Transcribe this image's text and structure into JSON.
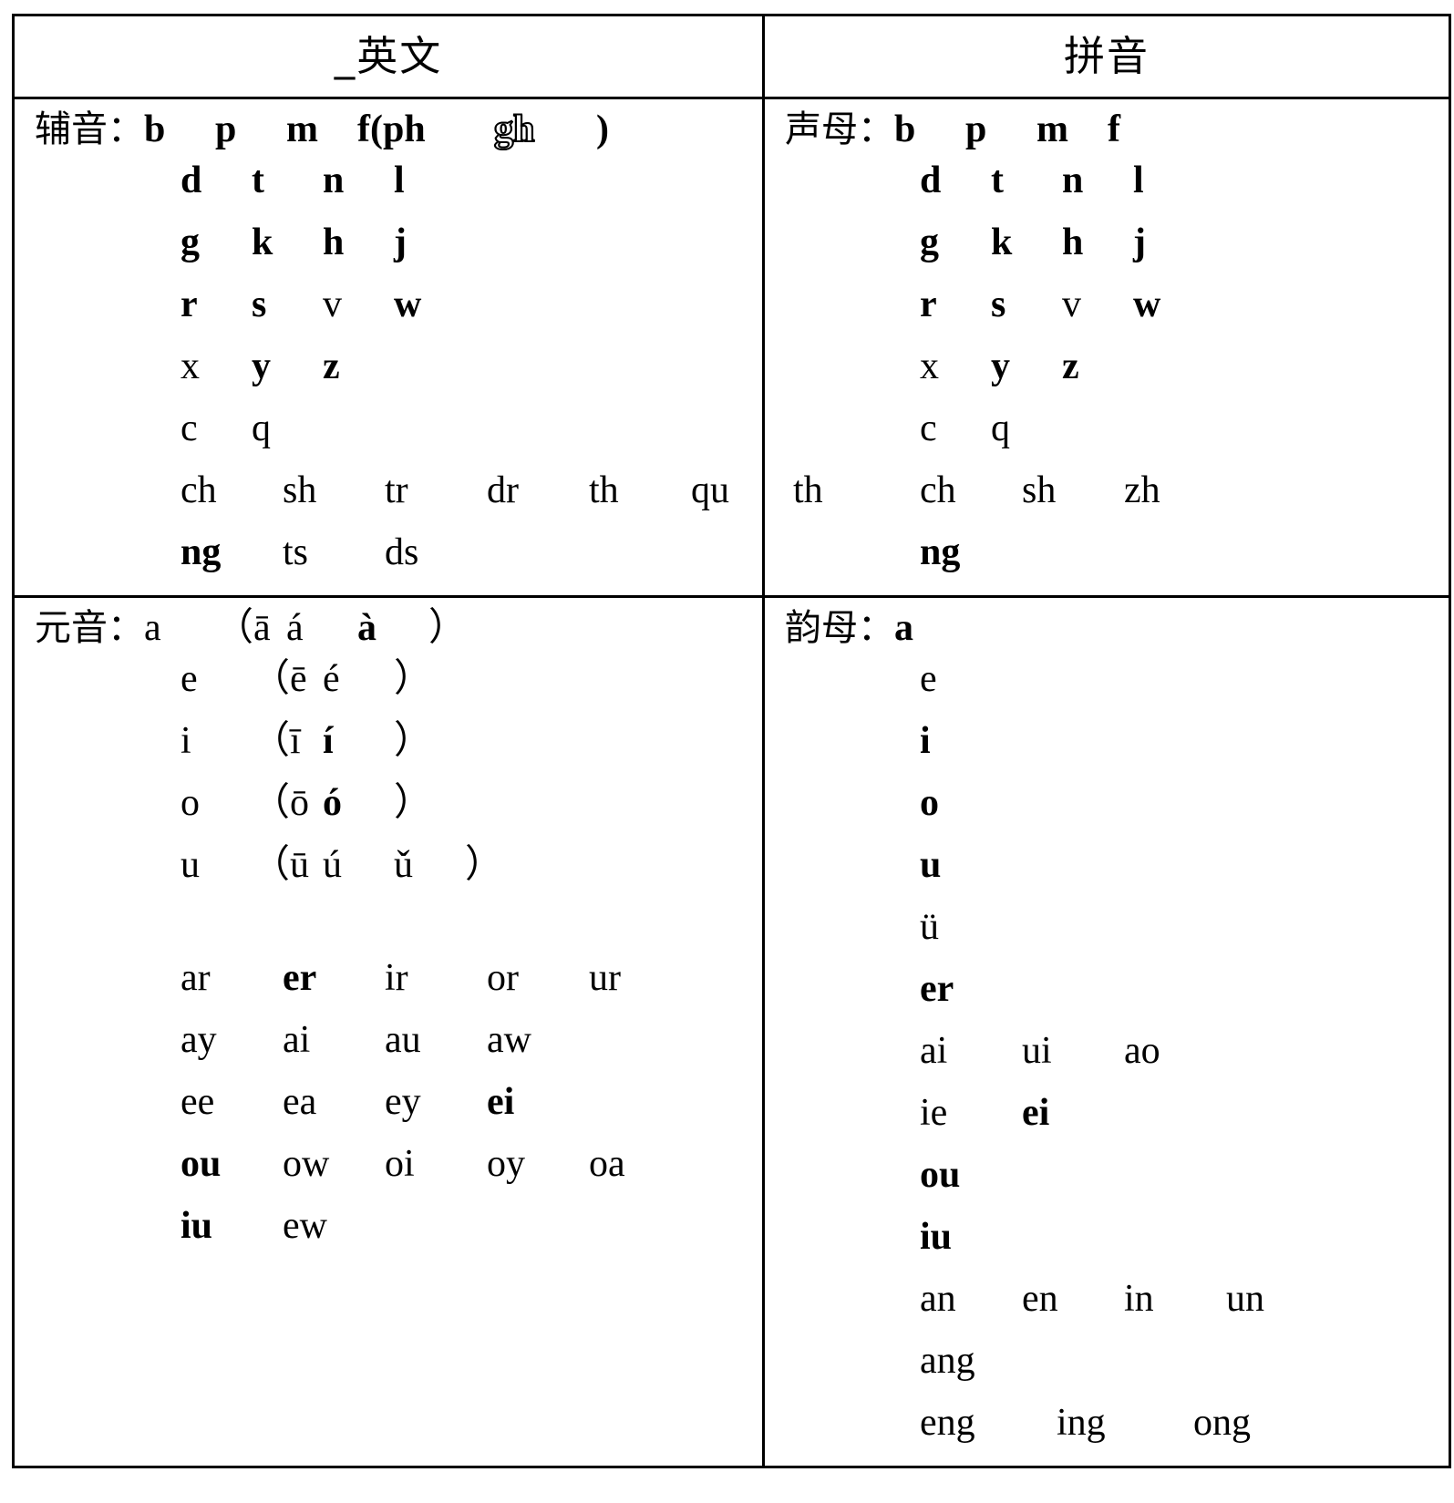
{
  "table": {
    "headers": {
      "english": "_英文",
      "pinyin": "拼音"
    },
    "rows": {
      "consonants": {
        "english": {
          "label": "辅音：",
          "lines": [
            [
              {
                "t": "b",
                "w": "bold"
              },
              {
                "t": "p",
                "w": "bold"
              },
              {
                "t": "m",
                "w": "bold"
              },
              {
                "t": "f(ph",
                "w": "bold"
              },
              {
                "t": "gh",
                "w": "outline"
              },
              {
                "t": ")",
                "w": "bold"
              }
            ],
            [
              {
                "t": "d",
                "w": "bold"
              },
              {
                "t": "t",
                "w": "bold"
              },
              {
                "t": "n",
                "w": "bold"
              },
              {
                "t": "l",
                "w": "bold"
              }
            ],
            [
              {
                "t": "g",
                "w": "bold"
              },
              {
                "t": "k",
                "w": "bold"
              },
              {
                "t": "h",
                "w": "bold"
              },
              {
                "t": "j",
                "w": "bold"
              }
            ],
            [
              {
                "t": "r",
                "w": "bold"
              },
              {
                "t": "s",
                "w": "bold"
              },
              {
                "t": "v",
                "w": "normal"
              },
              {
                "t": "w",
                "w": "bold"
              }
            ],
            [
              {
                "t": "x",
                "w": "normal"
              },
              {
                "t": "y",
                "w": "bold"
              },
              {
                "t": "z",
                "w": "bold"
              }
            ],
            [
              {
                "t": "c",
                "w": "normal"
              },
              {
                "t": "q",
                "w": "normal"
              }
            ],
            [
              {
                "t": "ch",
                "w": "normal"
              },
              {
                "t": "sh",
                "w": "normal"
              },
              {
                "t": "tr",
                "w": "normal"
              },
              {
                "t": "dr",
                "w": "normal"
              },
              {
                "t": "th",
                "w": "normal"
              },
              {
                "t": "qu",
                "w": "normal"
              },
              {
                "t": "th",
                "w": "normal"
              }
            ],
            [
              {
                "t": "ng",
                "w": "bold"
              },
              {
                "t": "ts",
                "w": "normal"
              },
              {
                "t": "ds",
                "w": "normal"
              }
            ]
          ]
        },
        "pinyin": {
          "label": "声母：",
          "lines": [
            [
              {
                "t": "b",
                "w": "bold"
              },
              {
                "t": "p",
                "w": "bold"
              },
              {
                "t": "m",
                "w": "bold"
              },
              {
                "t": "f",
                "w": "bold"
              }
            ],
            [
              {
                "t": "d",
                "w": "bold"
              },
              {
                "t": "t",
                "w": "bold"
              },
              {
                "t": "n",
                "w": "bold"
              },
              {
                "t": "l",
                "w": "bold"
              }
            ],
            [
              {
                "t": "g",
                "w": "bold"
              },
              {
                "t": "k",
                "w": "bold"
              },
              {
                "t": "h",
                "w": "bold"
              },
              {
                "t": "j",
                "w": "bold"
              }
            ],
            [
              {
                "t": "r",
                "w": "bold"
              },
              {
                "t": "s",
                "w": "bold"
              },
              {
                "t": "v",
                "w": "normal"
              },
              {
                "t": "w",
                "w": "bold"
              }
            ],
            [
              {
                "t": "x",
                "w": "normal"
              },
              {
                "t": "y",
                "w": "bold"
              },
              {
                "t": "z",
                "w": "bold"
              }
            ],
            [
              {
                "t": "c",
                "w": "normal"
              },
              {
                "t": "q",
                "w": "normal"
              }
            ],
            [
              {
                "t": "ch",
                "w": "normal"
              },
              {
                "t": "sh",
                "w": "normal"
              },
              {
                "t": "zh",
                "w": "normal"
              }
            ],
            [
              {
                "t": "ng",
                "w": "bold"
              }
            ]
          ]
        }
      },
      "vowels": {
        "english": {
          "label": "元音：",
          "lines": [
            [
              {
                "t": "a",
                "w": "normal"
              },
              {
                "t": "（ā",
                "w": "normal"
              },
              {
                "t": "á",
                "w": "normal"
              },
              {
                "t": "à",
                "w": "bold"
              },
              {
                "t": "）",
                "w": "normal"
              }
            ],
            [
              {
                "t": "e",
                "w": "normal"
              },
              {
                "t": "（ē",
                "w": "normal"
              },
              {
                "t": "é",
                "w": "normal"
              },
              {
                "t": "）",
                "w": "normal"
              }
            ],
            [
              {
                "t": "i",
                "w": "normal"
              },
              {
                "t": "（ī",
                "w": "normal"
              },
              {
                "t": "í",
                "w": "bold"
              },
              {
                "t": "）",
                "w": "normal"
              }
            ],
            [
              {
                "t": "o",
                "w": "normal"
              },
              {
                "t": "（ō",
                "w": "normal"
              },
              {
                "t": "ó",
                "w": "bold"
              },
              {
                "t": "）",
                "w": "normal"
              }
            ],
            [
              {
                "t": "u",
                "w": "normal"
              },
              {
                "t": "（ū",
                "w": "normal"
              },
              {
                "t": "ú",
                "w": "normal"
              },
              {
                "t": "ǔ",
                "w": "normal"
              },
              {
                "t": "）",
                "w": "normal"
              }
            ],
            [],
            [
              {
                "t": "ar",
                "w": "normal"
              },
              {
                "t": "er",
                "w": "bold"
              },
              {
                "t": "ir",
                "w": "normal"
              },
              {
                "t": "or",
                "w": "normal"
              },
              {
                "t": "ur",
                "w": "normal"
              }
            ],
            [
              {
                "t": "ay",
                "w": "normal"
              },
              {
                "t": "ai",
                "w": "normal"
              },
              {
                "t": "au",
                "w": "normal"
              },
              {
                "t": "aw",
                "w": "normal"
              }
            ],
            [
              {
                "t": "ee",
                "w": "normal"
              },
              {
                "t": "ea",
                "w": "normal"
              },
              {
                "t": "ey",
                "w": "normal"
              },
              {
                "t": "ei",
                "w": "bold"
              }
            ],
            [
              {
                "t": "ou",
                "w": "bold"
              },
              {
                "t": "ow",
                "w": "normal"
              },
              {
                "t": "oi",
                "w": "normal"
              },
              {
                "t": "oy",
                "w": "normal"
              },
              {
                "t": "oa",
                "w": "normal"
              }
            ],
            [
              {
                "t": "iu",
                "w": "bold"
              },
              {
                "t": "ew",
                "w": "normal"
              }
            ]
          ]
        },
        "pinyin": {
          "label": "韵母：",
          "lines": [
            [
              {
                "t": "a",
                "w": "bold"
              }
            ],
            [
              {
                "t": "e",
                "w": "normal"
              }
            ],
            [
              {
                "t": "i",
                "w": "bold"
              }
            ],
            [
              {
                "t": "o",
                "w": "bold"
              }
            ],
            [
              {
                "t": "u",
                "w": "bold"
              }
            ],
            [
              {
                "t": "ü",
                "w": "normal"
              }
            ],
            [
              {
                "t": "er",
                "w": "bold"
              }
            ],
            [
              {
                "t": "ai",
                "w": "normal"
              },
              {
                "t": "ui",
                "w": "normal"
              },
              {
                "t": "ao",
                "w": "normal"
              }
            ],
            [
              {
                "t": "ie",
                "w": "normal"
              },
              {
                "t": "ei",
                "w": "bold"
              }
            ],
            [
              {
                "t": "ou",
                "w": "bold"
              }
            ],
            [
              {
                "t": "iu",
                "w": "bold"
              }
            ],
            [
              {
                "t": "an",
                "w": "normal"
              },
              {
                "t": "en",
                "w": "normal"
              },
              {
                "t": "in",
                "w": "normal"
              },
              {
                "t": "un",
                "w": "normal"
              }
            ],
            [
              {
                "t": "ang",
                "w": "normal"
              }
            ],
            [
              {
                "t": "eng",
                "w": "normal"
              },
              {
                "t": "ing",
                "w": "normal"
              },
              {
                "t": "ong",
                "w": "normal"
              }
            ]
          ]
        }
      }
    }
  },
  "colors": {
    "ink": "#000000",
    "paper": "#ffffff"
  }
}
